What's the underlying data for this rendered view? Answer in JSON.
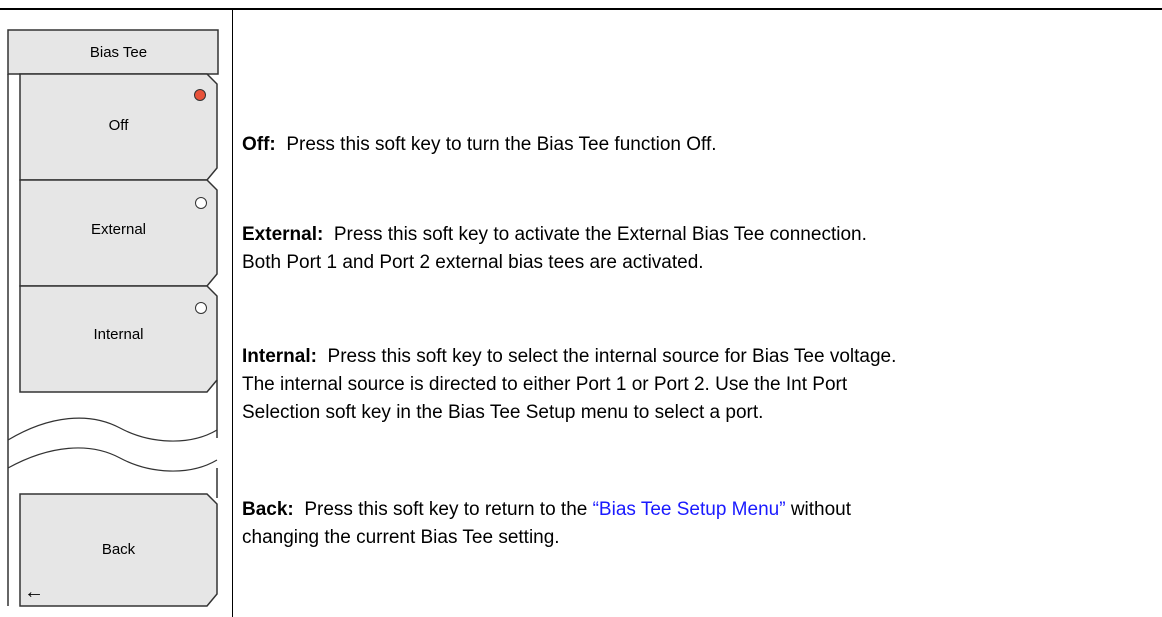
{
  "menu": {
    "title": "Bias Tee",
    "keys": [
      {
        "label": "Off",
        "selected": true
      },
      {
        "label": "External",
        "selected": false
      },
      {
        "label": "Internal",
        "selected": false
      },
      {
        "label": "Back",
        "icon": "left-arrow-icon"
      }
    ],
    "back_arrow": "←"
  },
  "descriptions": {
    "off": {
      "term": "Off:",
      "text": "Press this soft key to turn the Bias Tee function Off."
    },
    "external": {
      "term": "External:",
      "line1": "Press this soft key to activate the External Bias Tee connection.",
      "line2": "Both Port 1 and Port 2 external bias tees are activated."
    },
    "internal": {
      "term": "Internal:",
      "line1": "Press this soft key to select the internal source for Bias Tee voltage.",
      "line2": "The internal source is directed to either Port 1 or Port 2. Use the Int Port",
      "line3": "Selection soft key in the Bias Tee Setup menu to select a port."
    },
    "back": {
      "term": "Back:",
      "text_before": "Press this soft key to return to the",
      "link": "“Bias Tee Setup Menu”",
      "text_after": "without",
      "line2": "changing the current Bias Tee setting."
    }
  },
  "colors": {
    "indicator_on": "#e8523a",
    "link": "#1a1aff",
    "key_fill": "#e6e6e6"
  }
}
